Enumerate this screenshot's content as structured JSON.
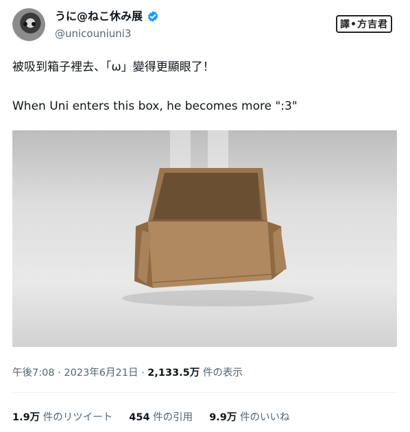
{
  "user": {
    "display_name": "うに@ねこ休み展",
    "handle": "@unicouniuni3"
  },
  "stamp": "譯•方吉君",
  "tweet": {
    "line1": "被吸到箱子裡去、「ω」變得更顯眼了！",
    "line2": "When Uni enters this box, he becomes more \":3\""
  },
  "meta": {
    "time": "午後7:08",
    "sep1": " · ",
    "date": "2023年6月21日",
    "sep2": " · ",
    "views_count": "2,133.5万",
    "views_label": " 件の表示"
  },
  "stats": {
    "retweets_count": "1.9万",
    "retweets_label": " 件のリツイート",
    "quotes_count": "454",
    "quotes_label": " 件の引用",
    "likes_count": "9.9万",
    "likes_label": " 件のいいね"
  },
  "colors": {
    "verified": "#1d9bf0",
    "muted": "#536471",
    "text": "#0f1419"
  }
}
